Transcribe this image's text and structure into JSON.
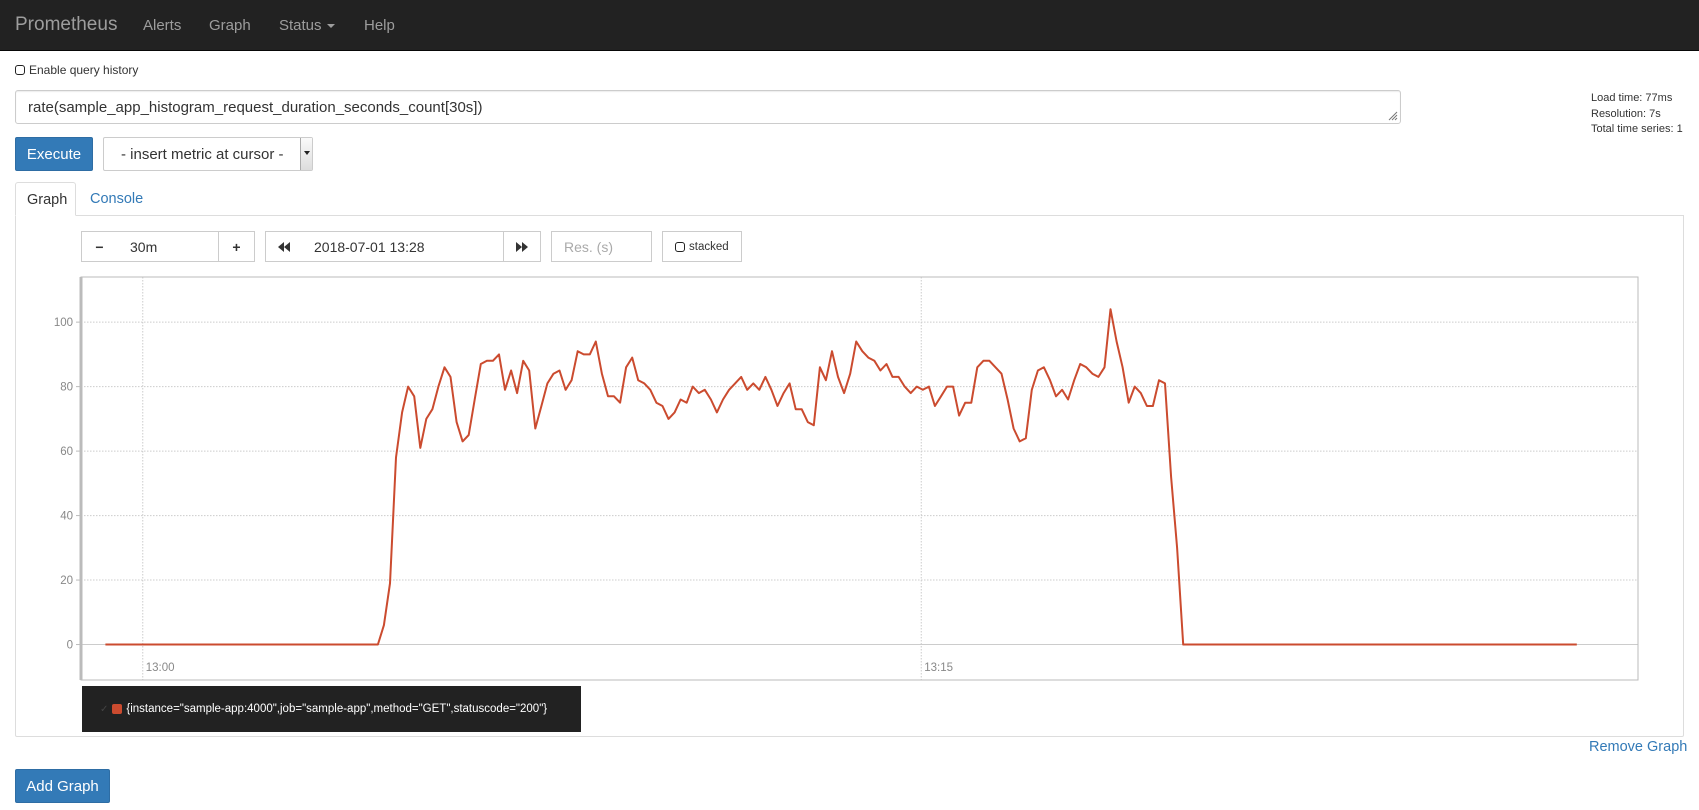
{
  "navbar": {
    "brand": "Prometheus",
    "items": [
      {
        "label": "Alerts"
      },
      {
        "label": "Graph"
      },
      {
        "label": "Status",
        "has_dropdown": true
      },
      {
        "label": "Help"
      }
    ]
  },
  "query_history": {
    "label": "Enable query history",
    "checked": false
  },
  "expression": {
    "value": "rate(sample_app_histogram_request_duration_seconds_count[30s])"
  },
  "stats": {
    "load_time": "Load time: 77ms",
    "resolution": "Resolution: 7s",
    "total_series": "Total time series: 1"
  },
  "execute_label": "Execute",
  "metric_select": {
    "selected": "- insert metric at cursor -"
  },
  "tabs": [
    {
      "label": "Graph",
      "active": true
    },
    {
      "label": "Console",
      "active": false
    }
  ],
  "graph_controls": {
    "range_minus": "−",
    "range_value": "30m",
    "range_plus": "+",
    "back_icon": "fast-backward-icon",
    "end_time": "2018-07-01 13:28",
    "forward_icon": "fast-forward-icon",
    "resolution_placeholder": "Res. (s)",
    "stacked_label": "stacked"
  },
  "legend": {
    "series_label": "{instance=\"sample-app:4000\",job=\"sample-app\",method=\"GET\",statuscode=\"200\"}",
    "color": "#cb4b2f"
  },
  "remove_graph_label": "Remove Graph",
  "add_graph_label": "Add Graph",
  "colors": {
    "accent": "#337ab7",
    "navbar_bg": "#222222",
    "series": "#cb4b2f"
  },
  "chart_data": {
    "type": "line",
    "title": "",
    "xlabel": "",
    "ylabel": "",
    "x_ticks": [
      {
        "label": "13:00",
        "minute": 0
      },
      {
        "label": "13:15",
        "minute": 15
      }
    ],
    "y_ticks": [
      0,
      20,
      40,
      60,
      80,
      100
    ],
    "ylim": [
      -11,
      114
    ],
    "xlim_minutes_from_1300": [
      -1.19,
      28.81
    ],
    "grid": true,
    "legend": "bottom-left",
    "series": [
      {
        "name": "{instance=\"sample-app:4000\",job=\"sample-app\",method=\"GET\",statuscode=\"200\"}",
        "start_minute": -0.72,
        "step_seconds": 7,
        "values": [
          0,
          0,
          0,
          0,
          0,
          0,
          0,
          0,
          0,
          0,
          0,
          0,
          0,
          0,
          0,
          0,
          0,
          0,
          0,
          0,
          0,
          0,
          0,
          0,
          0,
          0,
          0,
          0,
          0,
          0,
          0,
          0,
          0,
          0,
          0,
          0,
          0,
          0,
          0,
          0,
          0,
          0,
          0,
          0,
          0,
          0,
          6,
          19,
          58,
          72,
          80,
          77,
          61,
          70,
          73,
          80,
          86,
          83,
          69,
          63,
          65,
          76,
          87,
          88,
          88,
          90,
          79,
          85,
          78,
          88,
          85,
          67,
          74,
          81,
          84,
          85,
          79,
          82,
          91,
          90,
          90,
          94,
          84,
          77,
          77,
          75,
          86,
          89,
          82,
          81,
          79,
          75,
          74,
          70,
          72,
          76,
          75,
          80,
          78,
          79,
          76,
          72,
          76,
          79,
          81,
          83,
          79,
          81,
          79,
          83,
          79,
          74,
          78,
          81,
          73,
          73,
          69,
          68,
          86,
          82,
          91,
          83,
          78,
          84,
          94,
          91,
          89,
          88,
          85,
          87,
          83,
          83,
          80,
          78,
          80,
          79,
          80,
          74,
          77,
          80,
          80,
          71,
          75,
          75,
          86,
          88,
          88,
          86,
          84,
          76,
          67,
          63,
          64,
          79,
          85,
          86,
          82,
          77,
          79,
          76,
          82,
          87,
          86,
          84,
          83,
          86,
          104,
          94,
          86,
          75,
          80,
          78,
          74,
          74,
          82,
          81,
          52,
          30,
          0,
          0,
          0,
          0,
          0,
          0,
          0,
          0,
          0,
          0,
          0,
          0,
          0,
          0,
          0,
          0,
          0,
          0,
          0,
          0,
          0,
          0,
          0,
          0,
          0,
          0,
          0,
          0,
          0,
          0,
          0,
          0,
          0,
          0,
          0,
          0,
          0,
          0,
          0,
          0,
          0,
          0,
          0,
          0,
          0,
          0,
          0,
          0,
          0,
          0,
          0,
          0,
          0,
          0,
          0,
          0,
          0,
          0,
          0,
          0,
          0,
          0,
          0,
          0,
          0,
          0
        ]
      }
    ]
  }
}
